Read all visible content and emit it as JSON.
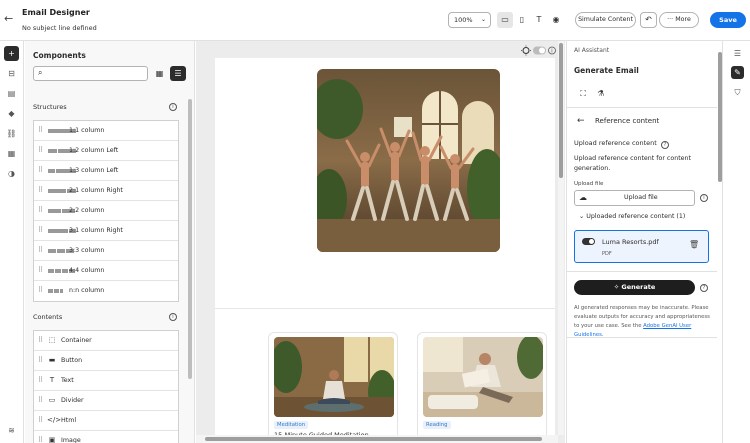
{
  "header": {
    "title": "Email Designer",
    "subtitle": "No subject line defined",
    "zoom": "100%",
    "simulate_label": "Simulate Content",
    "more_label": "More",
    "save_label": "Save"
  },
  "components": {
    "title": "Components",
    "search_placeholder": "",
    "structures_label": "Structures",
    "structures": [
      {
        "label": "1:1 column",
        "glyph": [
          28
        ]
      },
      {
        "label": "1:2 column Left",
        "glyph": [
          9,
          18
        ]
      },
      {
        "label": "1:3 column Left",
        "glyph": [
          7,
          20
        ]
      },
      {
        "label": "2:1 column Right",
        "glyph": [
          18,
          9
        ]
      },
      {
        "label": "2:2 column",
        "glyph": [
          13,
          13
        ]
      },
      {
        "label": "3:1 column Right",
        "glyph": [
          20,
          7
        ]
      },
      {
        "label": "3:3 column",
        "glyph": [
          8,
          8,
          8
        ]
      },
      {
        "label": "4:4 column",
        "glyph": [
          6,
          6,
          6,
          6
        ]
      },
      {
        "label": "n:n column",
        "glyph": [
          5,
          5,
          3
        ]
      }
    ],
    "contents_label": "Contents",
    "contents": [
      {
        "label": "Container",
        "icon": "container-icon",
        "glyph": "⬚"
      },
      {
        "label": "Button",
        "icon": "button-icon",
        "glyph": "▬"
      },
      {
        "label": "Text",
        "icon": "text-icon",
        "glyph": "T"
      },
      {
        "label": "Divider",
        "icon": "divider-icon",
        "glyph": "▭"
      },
      {
        "label": "Html",
        "icon": "html-icon",
        "glyph": "</>"
      },
      {
        "label": "Image",
        "icon": "image-icon",
        "glyph": "▣"
      }
    ]
  },
  "canvas": {
    "cards": [
      {
        "tag": "Meditation",
        "title": "15-Minute Guided Meditation"
      },
      {
        "tag": "Reading",
        "title": ""
      }
    ]
  },
  "ai": {
    "label": "AI Assistant",
    "title": "Generate Email",
    "ref_title": "Reference content",
    "ref_heading": "Upload reference content",
    "ref_desc": "Upload reference content for content generation.",
    "upload_label": "Upload file",
    "upload_button": "Upload file",
    "uploaded_toggle": "Uploaded reference content (1)",
    "file_name": "Luma Resorts.pdf",
    "file_type": "PDF",
    "generate_label": "Generate",
    "disclaimer": "AI generated responses may be inaccurate. Please evaluate outputs for accuracy and appropriateness to your use case. See the",
    "disclaimer_link": "Adobe GenAI User Guidelines",
    "disclaimer_end": "."
  },
  "colors": {
    "accent": "#1473e6",
    "dark": "#1e1e1e",
    "tag_bg": "#e8f0fb"
  }
}
